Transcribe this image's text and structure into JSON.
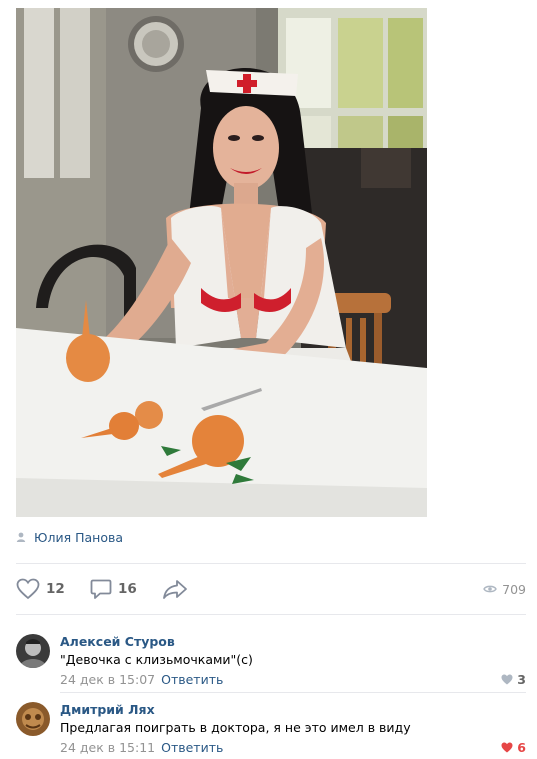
{
  "post": {
    "photo_icon": "nurse-photo",
    "author_icon": "user-icon",
    "author": "Юлия Панова"
  },
  "actions": {
    "likes": "12",
    "comments": "16",
    "views": "709",
    "like_icon": "heart-icon",
    "comment_icon": "comment-icon",
    "share_icon": "share-icon",
    "views_icon": "eye-icon"
  },
  "comments": [
    {
      "name": "Алексей Стуров",
      "text": "\"Девочка с клизьмочками\"(с)",
      "date": "24 дек в 15:07",
      "reply": "Ответить",
      "likes": "3",
      "liked": false
    },
    {
      "name": "Дмитрий Лях",
      "text": "Предлагая поиграть в доктора, я не это имел в виду",
      "date": "24 дек в 15:11",
      "reply": "Ответить",
      "likes": "6",
      "liked": true
    }
  ],
  "colors": {
    "link": "#2a5885",
    "muted": "#939393",
    "icon": "#828a99",
    "liked": "#e64646",
    "divider": "#e7e8ec"
  }
}
